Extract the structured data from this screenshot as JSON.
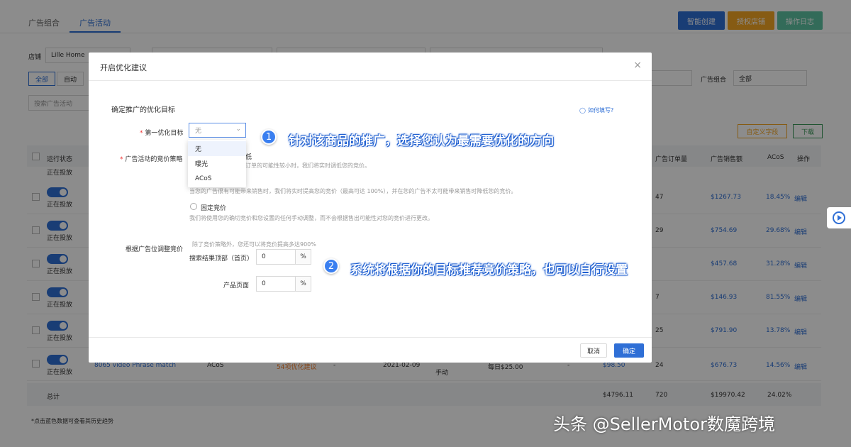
{
  "tabs": [
    "广告组合",
    "广告活动"
  ],
  "top_buttons": {
    "smart": "智能创建",
    "auth": "授权店铺",
    "log": "操作日志"
  },
  "filters": {
    "store_label": "店铺",
    "store_value": "Lille Home",
    "all": "全部",
    "auto": "自动",
    "portfolio_label": "广告组合",
    "portfolio_value": "全部",
    "search_placeholder": "搜索广告活动"
  },
  "actions": {
    "custom": "自定义字段",
    "download": "下载"
  },
  "table": {
    "headers": {
      "status": "运行状态",
      "orders": "广告订单量",
      "sales": "广告销售额",
      "acos": "ACoS",
      "ops": "操作"
    },
    "status_text": "正在投放",
    "rows": [
      {
        "orders": "47",
        "sales": "$1267.73",
        "acos": "18.45%"
      },
      {
        "orders": "29",
        "sales": "$754.69",
        "acos": "29.68%"
      },
      {
        "orders": "",
        "sales": "$457.68",
        "acos": "31.28%"
      },
      {
        "orders": "7",
        "sales": "$146.93",
        "acos": "81.55%"
      },
      {
        "orders": "25",
        "sales": "$791.90",
        "acos": "13.78%"
      },
      {
        "orders": "24",
        "sales": "$676.73",
        "acos": "14.56%"
      }
    ],
    "last_row": {
      "name": "8065 video Phrase match",
      "type": "ACoS",
      "suggest": "54项优化建议",
      "dash": "-",
      "date": "2021-02-09",
      "manual": "手动",
      "budget": "每日$25.00",
      "dash2": "-",
      "spend": "$98.50"
    },
    "edit_label": "编辑",
    "total": {
      "label": "总计",
      "spend": "$4796.11",
      "orders": "720",
      "sales": "$19970.42",
      "acos": "24.02%"
    }
  },
  "footnote": "*点击蓝色数据可查看其历史趋势",
  "modal": {
    "title": "开启优化建议",
    "section_title": "确定推广的优化目标",
    "help_link": "如何填写?",
    "first_goal_label": "第一优化目标",
    "first_goal_value": "无",
    "bid_strategy_label": "广告活动的竞价策略",
    "bid_line1_tail": "低",
    "bid_desc1": "订单的可能性较小时，我们将实时调低您的竞价。",
    "bid_desc2": "当您的广告很有可能带来销售时，我们将实时提高您的竞价（最高可达 100%），并在您的广告不太可能带来销售时降低您的竞价。",
    "fixed_bid": "固定竞价",
    "fixed_desc": "我们将使用您的确切竞价和您设置的任何手动调整，而不会根据售出可能性对您的竞价进行更改。",
    "placement_label": "根据广告位调整竞价",
    "placement_desc": "除了竞价策略外，您还可以将竞价提高多达900%",
    "top_search_label": "搜索结果顶部（首页）",
    "top_search_value": "0",
    "product_page_label": "产品页面",
    "product_page_value": "0",
    "pct": "%",
    "cancel": "取消",
    "confirm": "确定",
    "dropdown": [
      "无",
      "曝光",
      "ACoS"
    ]
  },
  "annotations": {
    "n1": "1",
    "text1": "针对该商品的推广，选择您认为最需要优化的方向",
    "n2": "2",
    "text2": "系统将根据你的目标推荐竞价策略，也可以自行设置"
  },
  "watermark": "头条 @SellerMotor数魔跨境"
}
